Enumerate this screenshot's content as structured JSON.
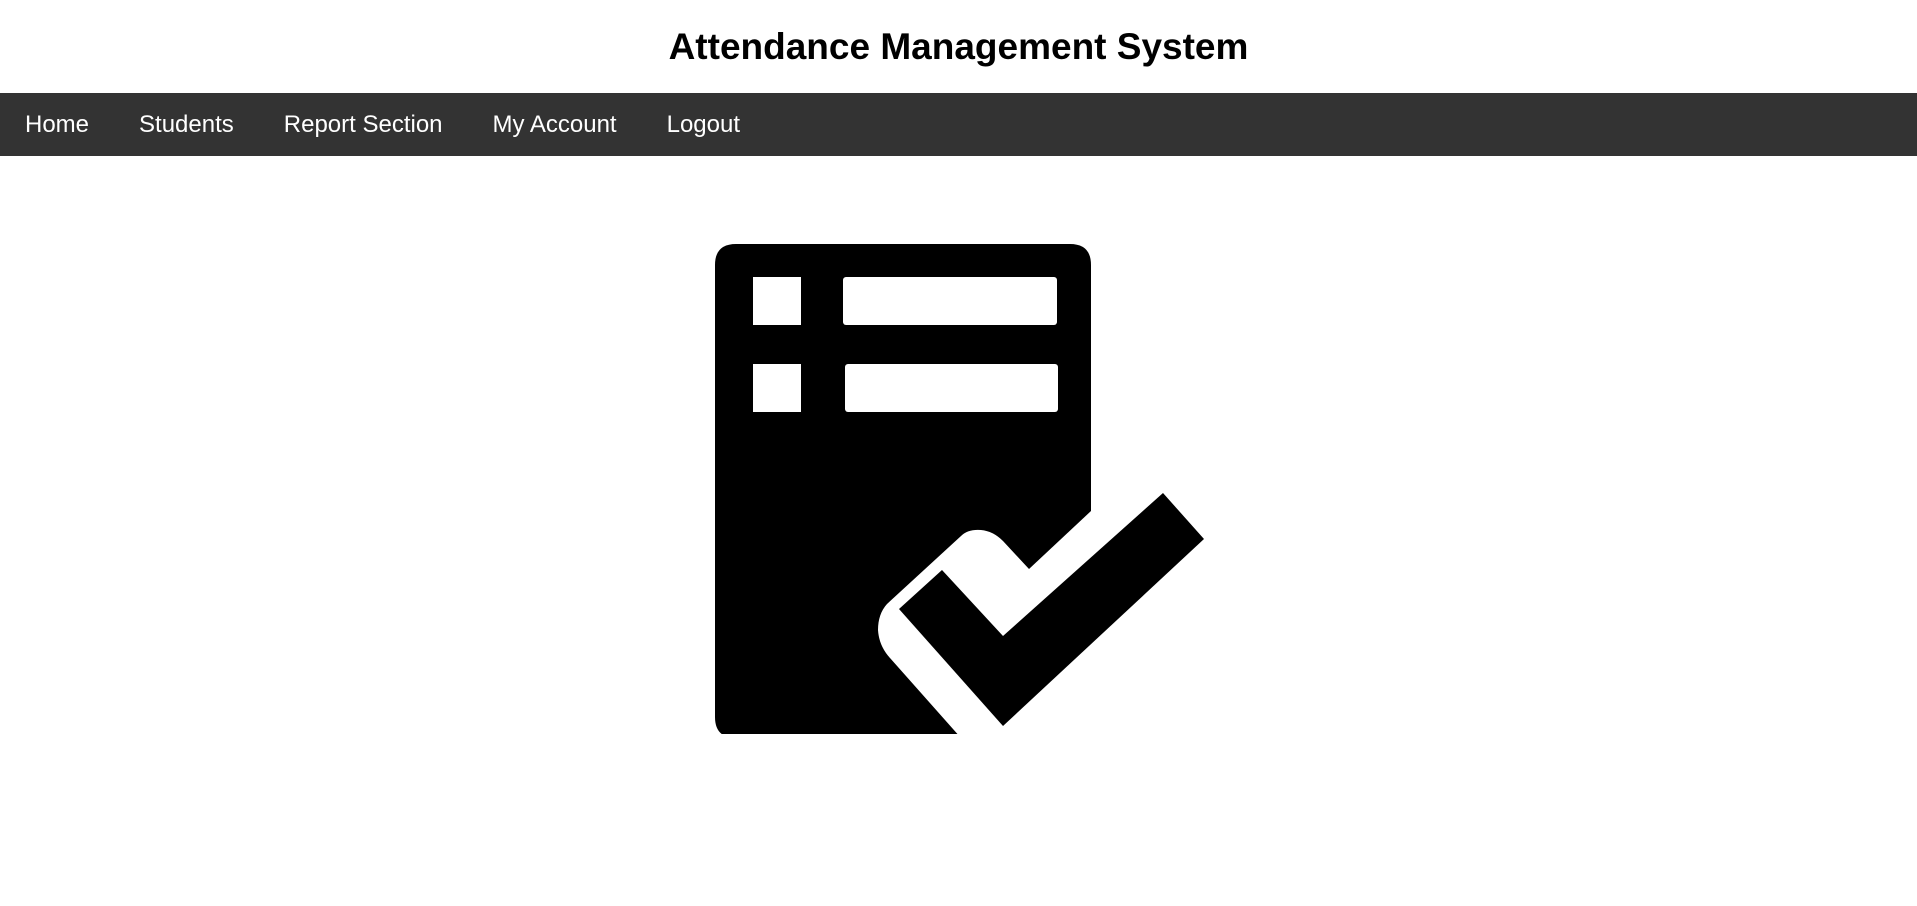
{
  "header": {
    "title": "Attendance Management System"
  },
  "nav": {
    "items": [
      {
        "label": "Home"
      },
      {
        "label": "Students"
      },
      {
        "label": "Report Section"
      },
      {
        "label": "My Account"
      },
      {
        "label": "Logout"
      }
    ]
  },
  "main": {
    "icon": "attendance-checklist-icon"
  },
  "colors": {
    "navbar_bg": "#333333",
    "nav_text": "#ffffff",
    "title_text": "#000000",
    "icon": "#000000"
  }
}
